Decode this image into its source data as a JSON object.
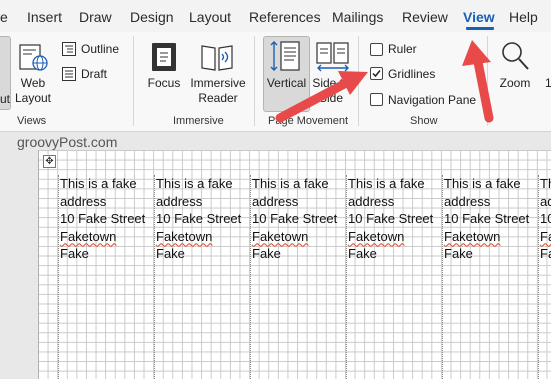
{
  "menu": {
    "tabs": [
      {
        "label": "e"
      },
      {
        "label": "Insert"
      },
      {
        "label": "Draw"
      },
      {
        "label": "Design"
      },
      {
        "label": "Layout"
      },
      {
        "label": "References"
      },
      {
        "label": "Mailings"
      },
      {
        "label": "Review"
      },
      {
        "label": "View"
      },
      {
        "label": "Help"
      }
    ],
    "active_tab": "View"
  },
  "ribbon": {
    "views": {
      "partial_label": "ut",
      "web_layout": "Web Layout",
      "outline": "Outline",
      "draft": "Draft",
      "group": "Views"
    },
    "immersive": {
      "focus": "Focus",
      "reader": "Immersive Reader",
      "group": "Immersive"
    },
    "page_movement": {
      "vertical": "Vertical",
      "side": "Side to Side",
      "group": "Page Movement"
    },
    "show": {
      "ruler": "Ruler",
      "ruler_checked": false,
      "gridlines": "Gridlines",
      "gridlines_checked": true,
      "navigation": "Navigation Pane",
      "navigation_checked": false,
      "group": "Show"
    },
    "zoom": {
      "label": "Zoom",
      "partial": "1"
    }
  },
  "watermark": "groovyPost.com",
  "labels": [
    {
      "lines": [
        "This is a fake",
        "address",
        "10 Fake Street",
        "Faketown",
        "Fake"
      ]
    },
    {
      "lines": [
        "This is a fake",
        "address",
        "10 Fake Street",
        "Faketown",
        "Fake"
      ]
    },
    {
      "lines": [
        "This is a fake",
        "address",
        "10 Fake Street",
        "Faketown",
        "Fake"
      ]
    },
    {
      "lines": [
        "This is a fake",
        "address",
        "10 Fake Street",
        "Faketown",
        "Fake"
      ]
    },
    {
      "lines": [
        "This is a fake",
        "address",
        "10 Fake Street",
        "Faketown",
        "Fake"
      ]
    },
    {
      "lines": [
        "Th",
        "ad",
        "10",
        "Fa",
        "Fa"
      ]
    }
  ],
  "annotation_color": "#e84a4a",
  "accent_color": "#1a5fb4"
}
